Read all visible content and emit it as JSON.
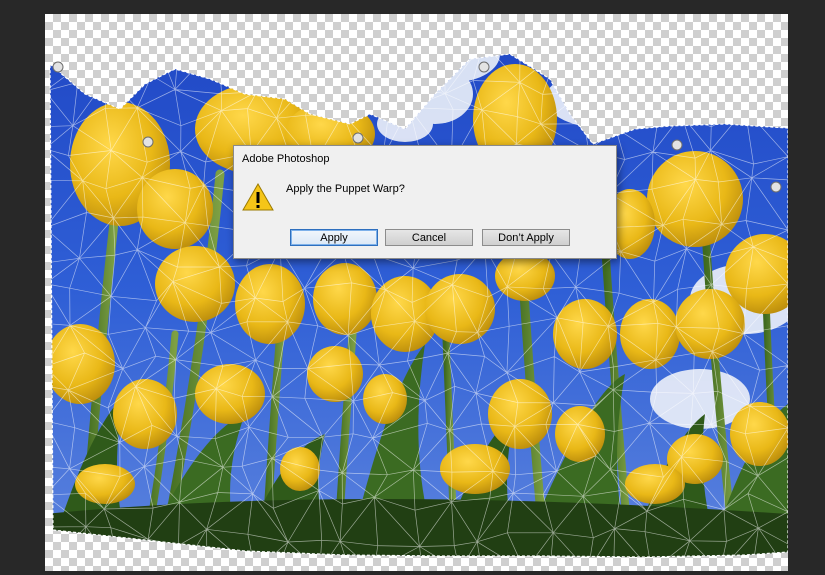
{
  "dialog": {
    "title": "Adobe Photoshop",
    "message": "Apply the Puppet Warp?",
    "icon": "warning-icon",
    "buttons": {
      "apply": "Apply",
      "cancel": "Cancel",
      "dont_apply": "Don’t Apply"
    }
  },
  "colors": {
    "highlight": "#10e60f",
    "dialog_background": "#f0f0f0",
    "default_button_border": "#2e6fbe",
    "workspace": "#282828"
  }
}
